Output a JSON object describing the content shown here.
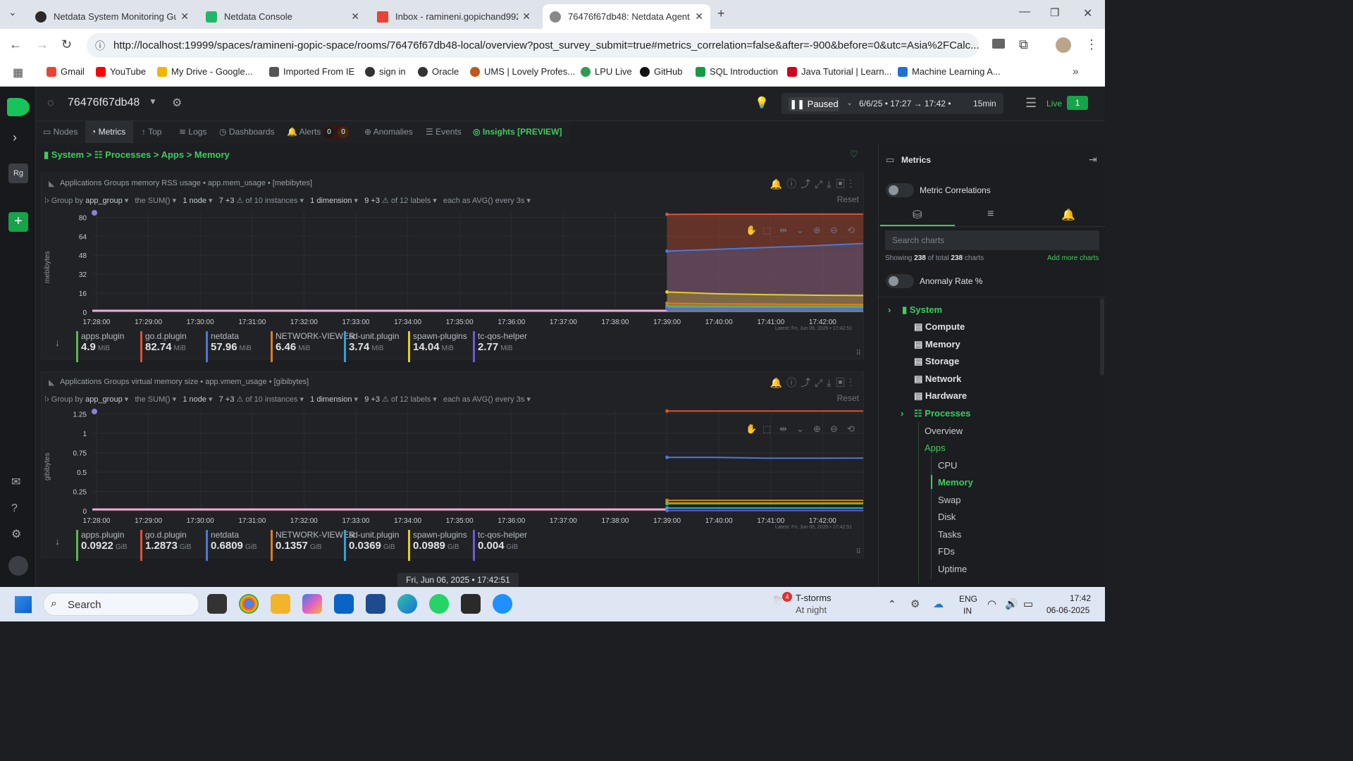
{
  "browser": {
    "tabs": [
      {
        "title": "Netdata System Monitoring Gu",
        "color": "#2a2a2a"
      },
      {
        "title": "Netdata Console",
        "color": "#1fb86b"
      },
      {
        "title": "Inbox - ramineni.gopichand992",
        "color": "#ea4335"
      },
      {
        "title": "76476f67db48: Netdata Agent C",
        "color": "#444"
      }
    ],
    "url": "http://localhost:19999/spaces/ramineni-gopic-space/rooms/76476f67db48-local/overview?post_survey_submit=true#metrics_correlation=false&after=-900&before=0&utc=Asia%2FCalc...",
    "bookmarks": [
      {
        "label": "Gmail",
        "color": "#ea4335"
      },
      {
        "label": "YouTube",
        "color": "#ff0000"
      },
      {
        "label": "My Drive - Google...",
        "color": "#f4b400"
      },
      {
        "label": "Imported From IE",
        "color": "#555"
      },
      {
        "label": "sign in",
        "color": "#333"
      },
      {
        "label": "Oracle",
        "color": "#333"
      },
      {
        "label": "UMS | Lovely Profes...",
        "color": "#c0561b"
      },
      {
        "label": "LPU Live",
        "color": "#2e9b55"
      },
      {
        "label": "GitHub",
        "color": "#111"
      },
      {
        "label": "SQL Introduction",
        "color": "#149a45"
      },
      {
        "label": "Java Tutorial | Learn...",
        "color": "#d0021b"
      },
      {
        "label": "Machine Learning A...",
        "color": "#1e6fd9"
      }
    ]
  },
  "netdata": {
    "node_name": "76476f67db48",
    "paused_label": "Paused",
    "time_range": "6/6/25 • 17:27 → 17:42 •",
    "duration": "15min",
    "live_label": "Live",
    "live_count": "1",
    "nav_tabs": [
      "Nodes",
      "Metrics",
      "Top",
      "Logs",
      "Dashboards",
      "Alerts",
      "Anomalies",
      "Events",
      "Insights [PREVIEW]"
    ],
    "alerts_counts": [
      "0",
      "0"
    ],
    "breadcrumb": [
      "System",
      ">",
      "Processes",
      ">",
      "Apps",
      ">",
      "Memory"
    ],
    "avatar_initials": "Rg"
  },
  "charts": [
    {
      "title": "Applications Groups memory RSS usage • app.mem_usage • [mebibytes]",
      "group_by": "app_group",
      "agg": "the SUM()",
      "nodes": "1 node",
      "instances": "7 +3",
      "of_instances": "of 10 instances",
      "dimensions": "1 dimension",
      "labels": "9 +3",
      "of_labels": "of 12 labels",
      "every": "each as AVG() every 3s",
      "reset": "Reset",
      "ylabel": "mebibytes",
      "latest": "Latest: Fri, Jun 06, 2025 • 17:42:51",
      "legend": [
        {
          "name": "apps.plugin",
          "value": "4.9",
          "unit": "MiB",
          "color": "#58b94a"
        },
        {
          "name": "go.d.plugin",
          "value": "82.74",
          "unit": "MiB",
          "color": "#e3502d"
        },
        {
          "name": "netdata",
          "value": "57.96",
          "unit": "MiB",
          "color": "#4a79d7"
        },
        {
          "name": "NETWORK-VIEWER",
          "value": "6.46",
          "unit": "MiB",
          "color": "#e07b1c"
        },
        {
          "name": "sd-unit.plugin",
          "value": "3.74",
          "unit": "MiB",
          "color": "#2fa3d8"
        },
        {
          "name": "spawn-plugins",
          "value": "14.04",
          "unit": "MiB",
          "color": "#e2d11d"
        },
        {
          "name": "tc-qos-helper",
          "value": "2.77",
          "unit": "MiB",
          "color": "#6e5ad8"
        }
      ]
    },
    {
      "title": "Applications Groups virtual memory size • app.vmem_usage • [gibibytes]",
      "group_by": "app_group",
      "agg": "the SUM()",
      "nodes": "1 node",
      "instances": "7 +3",
      "of_instances": "of 10 instances",
      "dimensions": "1 dimension",
      "labels": "9 +3",
      "of_labels": "of 12 labels",
      "every": "each as AVG() every 3s",
      "reset": "Reset",
      "ylabel": "gibibytes",
      "latest": "Latest: Fri, Jun 06, 2025 • 17:42:51",
      "legend": [
        {
          "name": "apps.plugin",
          "value": "0.0922",
          "unit": "GiB",
          "color": "#58b94a"
        },
        {
          "name": "go.d.plugin",
          "value": "1.2873",
          "unit": "GiB",
          "color": "#e3502d"
        },
        {
          "name": "netdata",
          "value": "0.6809",
          "unit": "GiB",
          "color": "#4a79d7"
        },
        {
          "name": "NETWORK-VIEWER",
          "value": "0.1357",
          "unit": "GiB",
          "color": "#e07b1c"
        },
        {
          "name": "sd-unit.plugin",
          "value": "0.0369",
          "unit": "GiB",
          "color": "#2fa3d8"
        },
        {
          "name": "spawn-plugins",
          "value": "0.0989",
          "unit": "GiB",
          "color": "#e2d11d"
        },
        {
          "name": "tc-qos-helper",
          "value": "0.004",
          "unit": "GiB",
          "color": "#6e5ad8"
        }
      ]
    }
  ],
  "chart_data": [
    {
      "type": "area",
      "title": "Applications Groups memory RSS usage • app.mem_usage • [mebibytes]",
      "ylabel": "mebibytes",
      "ylim": [
        0,
        85
      ],
      "yticks": [
        0,
        16,
        32,
        48,
        64,
        80
      ],
      "x": [
        "17:28:00",
        "17:29:00",
        "17:30:00",
        "17:31:00",
        "17:32:00",
        "17:33:00",
        "17:34:00",
        "17:35:00",
        "17:36:00",
        "17:37:00",
        "17:38:00",
        "17:39:00",
        "17:40:00",
        "17:41:00",
        "17:42:00"
      ],
      "data_start": "17:39:00",
      "series": [
        {
          "name": "go.d.plugin",
          "color": "#e3502d",
          "values": [
            82.5,
            82.6,
            82.6,
            82.7,
            82.7
          ]
        },
        {
          "name": "netdata",
          "color": "#4a79d7",
          "values": [
            51.5,
            53.0,
            54.5,
            56.0,
            57.96
          ]
        },
        {
          "name": "spawn-plugins",
          "color": "#e2d11d",
          "values": [
            17.0,
            15.5,
            14.8,
            14.3,
            14.04
          ]
        },
        {
          "name": "NETWORK-VIEWER",
          "color": "#e07b1c",
          "values": [
            7.5,
            7.0,
            6.8,
            6.6,
            6.46
          ]
        },
        {
          "name": "apps.plugin",
          "color": "#58b94a",
          "values": [
            5.2,
            5.0,
            4.9,
            4.9,
            4.9
          ]
        },
        {
          "name": "sd-unit.plugin",
          "color": "#2fa3d8",
          "values": [
            3.8,
            3.8,
            3.7,
            3.7,
            3.74
          ]
        },
        {
          "name": "tc-qos-helper",
          "color": "#6e5ad8",
          "values": [
            2.8,
            2.8,
            2.8,
            2.8,
            2.77
          ]
        }
      ]
    },
    {
      "type": "line",
      "title": "Applications Groups virtual memory size • app.vmem_usage • [gibibytes]",
      "ylabel": "gibibytes",
      "ylim": [
        0,
        1.3
      ],
      "yticks": [
        "0",
        "0.25",
        "0.5",
        "0.75",
        "1",
        "1.25"
      ],
      "x": [
        "17:28:00",
        "17:29:00",
        "17:30:00",
        "17:31:00",
        "17:32:00",
        "17:33:00",
        "17:34:00",
        "17:35:00",
        "17:36:00",
        "17:37:00",
        "17:38:00",
        "17:39:00",
        "17:40:00",
        "17:41:00",
        "17:42:00"
      ],
      "data_start": "17:39:00",
      "series": [
        {
          "name": "go.d.plugin",
          "color": "#e3502d",
          "values": [
            1.2873,
            1.2873,
            1.2873,
            1.2873,
            1.2873
          ]
        },
        {
          "name": "netdata",
          "color": "#4a79d7",
          "values": [
            0.69,
            0.69,
            0.68,
            0.68,
            0.6809
          ]
        },
        {
          "name": "NETWORK-VIEWER",
          "color": "#e07b1c",
          "values": [
            0.1357,
            0.1357,
            0.1357,
            0.1357,
            0.1357
          ]
        },
        {
          "name": "spawn-plugins",
          "color": "#e2d11d",
          "values": [
            0.0989,
            0.0989,
            0.0989,
            0.0989,
            0.0989
          ]
        },
        {
          "name": "apps.plugin",
          "color": "#58b94a",
          "values": [
            0.0922,
            0.0922,
            0.0922,
            0.0922,
            0.0922
          ]
        },
        {
          "name": "sd-unit.plugin",
          "color": "#2fa3d8",
          "values": [
            0.0369,
            0.0369,
            0.0369,
            0.0369,
            0.0369
          ]
        },
        {
          "name": "tc-qos-helper",
          "color": "#6e5ad8",
          "values": [
            0.004,
            0.004,
            0.004,
            0.004,
            0.004
          ]
        }
      ]
    }
  ],
  "right_panel": {
    "title": "Metrics",
    "metric_correlations": "Metric Correlations",
    "search_placeholder": "Search charts",
    "showing_prefix": "Showing",
    "showing_count": "238",
    "showing_mid": "of total",
    "showing_total": "238",
    "showing_suffix": "charts",
    "add_more": "Add more charts",
    "anomaly_rate": "Anomaly Rate %",
    "tree": [
      "System",
      "Compute",
      "Memory",
      "Storage",
      "Network",
      "Hardware",
      "Processes",
      "Overview",
      "Apps",
      "CPU",
      "Memory",
      "Swap",
      "Disk",
      "Tasks",
      "FDs",
      "Uptime"
    ]
  },
  "footer_time": "Fri, Jun 06, 2025 • 17:42:51",
  "taskbar": {
    "search": "Search",
    "weather_title": "T-storms",
    "weather_sub": "At night",
    "weather_badge": "4",
    "lang1": "ENG",
    "lang2": "IN",
    "time": "17:42",
    "date": "06-06-2025"
  }
}
